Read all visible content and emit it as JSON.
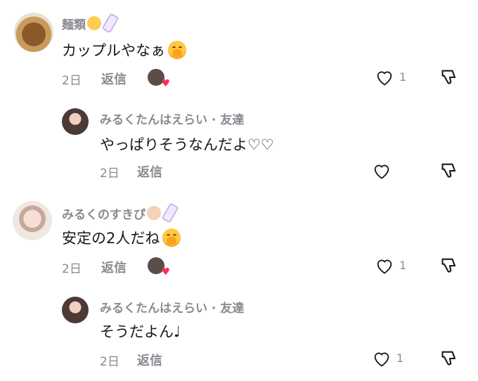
{
  "comments": [
    {
      "name": "麺類",
      "text": "カップルやなぁ",
      "time": "2日",
      "reply_label": "返信",
      "like_count": "1",
      "avatar": "ramen-avatar"
    },
    {
      "name": "みるくたんはえらい · 友達",
      "text": "やっぱりそうなんだよ♡♡",
      "time": "2日",
      "reply_label": "返信",
      "like_count": "",
      "avatar": "girl-avatar"
    },
    {
      "name": "みるくのすきぴ",
      "text": "安定の2人だね",
      "time": "2日",
      "reply_label": "返信",
      "like_count": "1",
      "avatar": "girl-avatar"
    },
    {
      "name": "みるくたんはえらい · 友達",
      "text": "そうだよん♩",
      "time": "2日",
      "reply_label": "返信",
      "like_count": "1",
      "avatar": "girl-avatar"
    }
  ],
  "icons": {
    "like": "heart-outline-icon",
    "dislike": "thumbs-down-icon",
    "creator_liked": "heart-filled-icon"
  },
  "colors": {
    "text": "#161823",
    "secondary": "#8a8b91",
    "heart": "#fe2c55"
  }
}
